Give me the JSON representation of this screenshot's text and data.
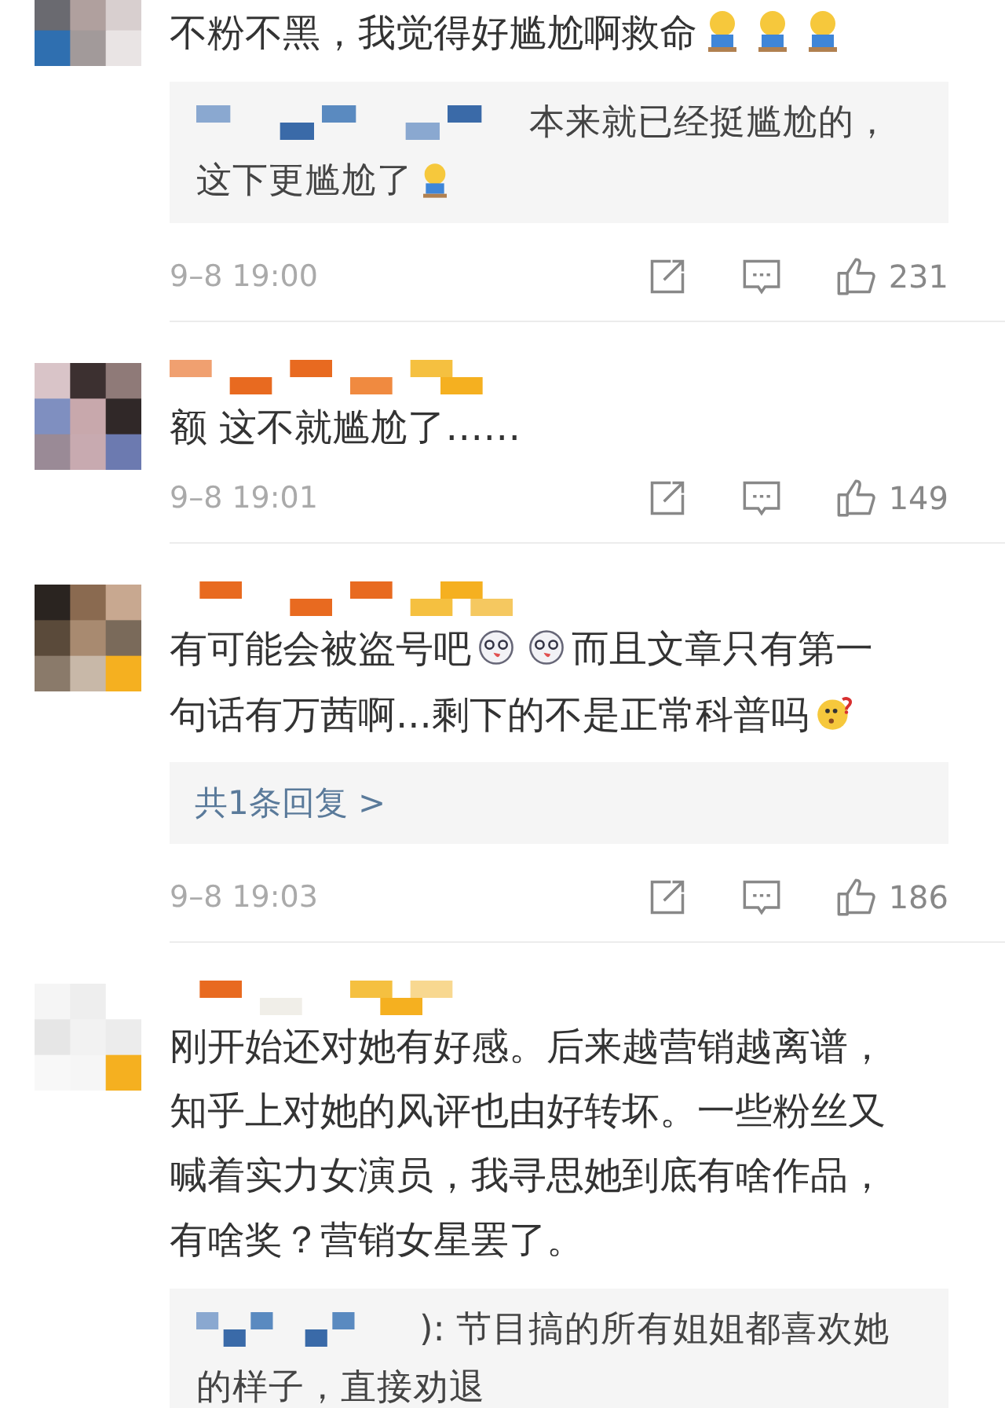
{
  "comments": [
    {
      "parts": [
        {
          "kind": "text",
          "text": "不粉不黑，我觉得好尴尬啊救命"
        },
        {
          "kind": "kneel-emoji"
        },
        {
          "kind": "kneel-emoji"
        },
        {
          "kind": "kneel-emoji"
        }
      ],
      "reply": {
        "parts": [
          {
            "kind": "text",
            "text": "本来就已经挺尴尬的，这下更尴尬了"
          },
          {
            "kind": "kneel-emoji"
          }
        ]
      },
      "time": "9–8 19:00",
      "likes": "231"
    },
    {
      "parts": [
        {
          "kind": "text",
          "text": "额 这不就尴尬了……"
        }
      ],
      "time": "9–8 19:01",
      "likes": "149"
    },
    {
      "parts": [
        {
          "kind": "text",
          "text": "有可能会被盗号吧"
        },
        {
          "kind": "dizzy-emoji"
        },
        {
          "kind": "dizzy-emoji"
        },
        {
          "kind": "text",
          "text": "而且文章只有第一句话有万茜啊...剩下的不是正常科普吗"
        },
        {
          "kind": "puzzled-emoji"
        }
      ],
      "more_replies": "共1条回复 >",
      "time": "9–8 19:03",
      "likes": "186"
    },
    {
      "parts": [
        {
          "kind": "text",
          "text": "刚开始还对她有好感。后来越营销越离谱，知乎上对她的风评也由好转坏。一些粉丝又喊着实力女演员，我寻思她到底有啥作品，有啥奖？营销女星罢了。"
        }
      ],
      "reply": {
        "parts": [
          {
            "kind": "text",
            "text": "): 节目搞的所有姐姐都喜欢她的样子，直接劝退"
          }
        ]
      }
    }
  ]
}
